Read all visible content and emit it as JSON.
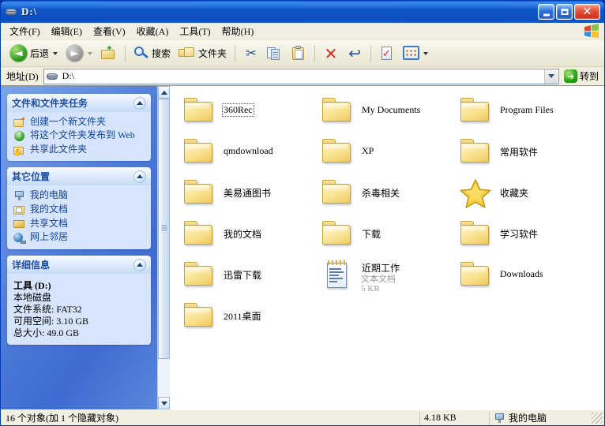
{
  "window": {
    "title": "D:\\",
    "title_icon": "drive-icon",
    "buttons": {
      "minimize": "_",
      "maximize": "□",
      "close": "✕"
    }
  },
  "menubar": {
    "items": [
      {
        "label": "文件(F)",
        "name": "menu-file"
      },
      {
        "label": "编辑(E)",
        "name": "menu-edit"
      },
      {
        "label": "查看(V)",
        "name": "menu-view"
      },
      {
        "label": "收藏(A)",
        "name": "menu-favorites"
      },
      {
        "label": "工具(T)",
        "name": "menu-tools"
      },
      {
        "label": "帮助(H)",
        "name": "menu-help"
      }
    ]
  },
  "toolbar": {
    "back": "后退",
    "forward": "",
    "up": "",
    "search": "搜索",
    "folders": "文件夹"
  },
  "addressbar": {
    "label": "地址(D)",
    "value": "D:\\",
    "go": "转到"
  },
  "sidebar": {
    "panels": [
      {
        "title": "文件和文件夹任务",
        "name": "panel-file-tasks",
        "links": [
          {
            "label": "创建一个新文件夹",
            "icon": "new-folder-icon"
          },
          {
            "label": "将这个文件夹发布到 Web",
            "icon": "publish-web-icon"
          },
          {
            "label": "共享此文件夹",
            "icon": "share-folder-icon"
          }
        ]
      },
      {
        "title": "其它位置",
        "name": "panel-other-places",
        "links": [
          {
            "label": "我的电脑",
            "icon": "my-computer-icon"
          },
          {
            "label": "我的文档",
            "icon": "my-documents-icon"
          },
          {
            "label": "共享文档",
            "icon": "shared-documents-icon"
          },
          {
            "label": "网上邻居",
            "icon": "network-places-icon"
          }
        ]
      },
      {
        "title": "详细信息",
        "name": "panel-details",
        "details": {
          "name": "工具 (D:)",
          "type": "本地磁盘",
          "filesystem": "文件系统: FAT32",
          "free": "可用空间: 3.10 GB",
          "total": "总大小: 49.0 GB"
        }
      }
    ]
  },
  "files": {
    "items": [
      {
        "label": "360Rec",
        "icon": "folder-icon",
        "focused": true
      },
      {
        "label": "My Documents",
        "icon": "folder-icon",
        "focused": false
      },
      {
        "label": "Program Files",
        "icon": "folder-icon",
        "focused": false
      },
      {
        "label": "qmdownload",
        "icon": "folder-icon",
        "focused": false
      },
      {
        "label": "XP",
        "icon": "folder-icon",
        "focused": false
      },
      {
        "label": "常用软件",
        "icon": "folder-icon",
        "focused": false
      },
      {
        "label": "美易通图书",
        "icon": "folder-icon",
        "focused": false
      },
      {
        "label": "杀毒相关",
        "icon": "folder-icon",
        "focused": false
      },
      {
        "label": "收藏夹",
        "icon": "star-icon",
        "focused": false
      },
      {
        "label": "我的文档",
        "icon": "folder-icon",
        "focused": false
      },
      {
        "label": "下载",
        "icon": "folder-open-icon",
        "focused": false
      },
      {
        "label": "学习软件",
        "icon": "folder-icon",
        "focused": false
      },
      {
        "label": "迅雷下载",
        "icon": "folder-icon",
        "focused": false
      },
      {
        "label": "近期工作",
        "icon": "text-document-icon",
        "focused": false,
        "sub1": "文本文档",
        "sub2": "5 KB"
      },
      {
        "label": "Downloads",
        "icon": "folder-icon",
        "focused": false
      },
      {
        "label": "2011桌面",
        "icon": "folder-icon",
        "focused": false
      }
    ]
  },
  "statusbar": {
    "objects": "16 个对象(加 1 个隐藏对象)",
    "size": "4.18 KB",
    "place": "我的电脑"
  }
}
